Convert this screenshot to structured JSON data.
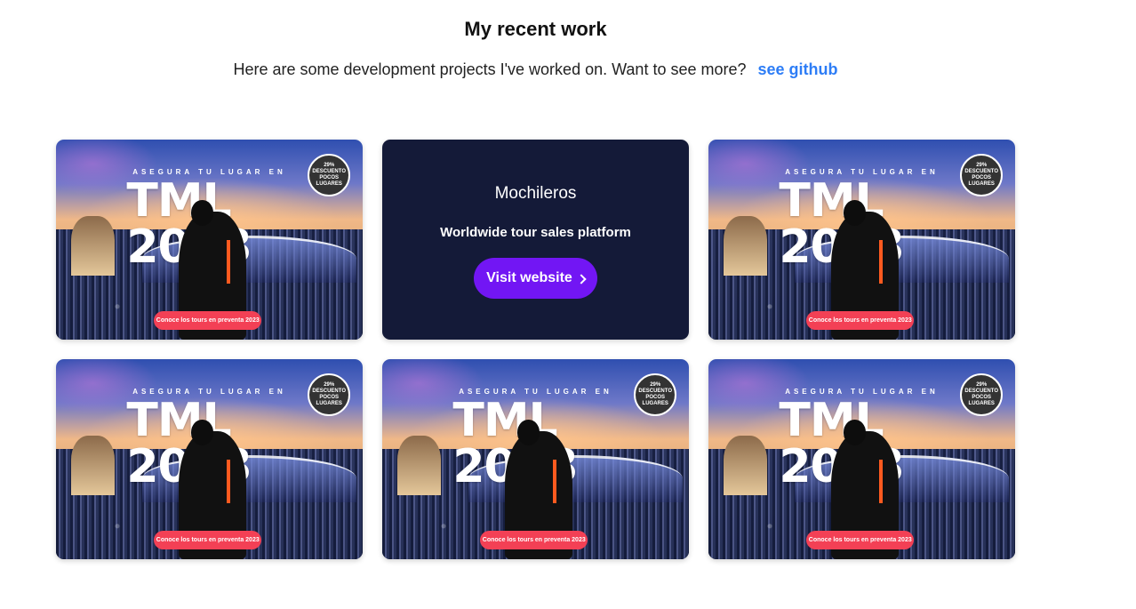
{
  "header": {
    "title": "My recent work",
    "subtitle": "Here are some development projects I've worked on. Want to see more?",
    "github_link": "see github"
  },
  "banner": {
    "kicker": "ASEGURA TU LUGAR EN",
    "title": "TML 2023",
    "discount": "29%\nDESCUENTO\nPOCOS LUGARES",
    "cta": "Conoce los tours en preventa 2023"
  },
  "featured": {
    "name": "Mochileros",
    "description": "Worldwide tour sales platform",
    "button": "Visit website"
  }
}
